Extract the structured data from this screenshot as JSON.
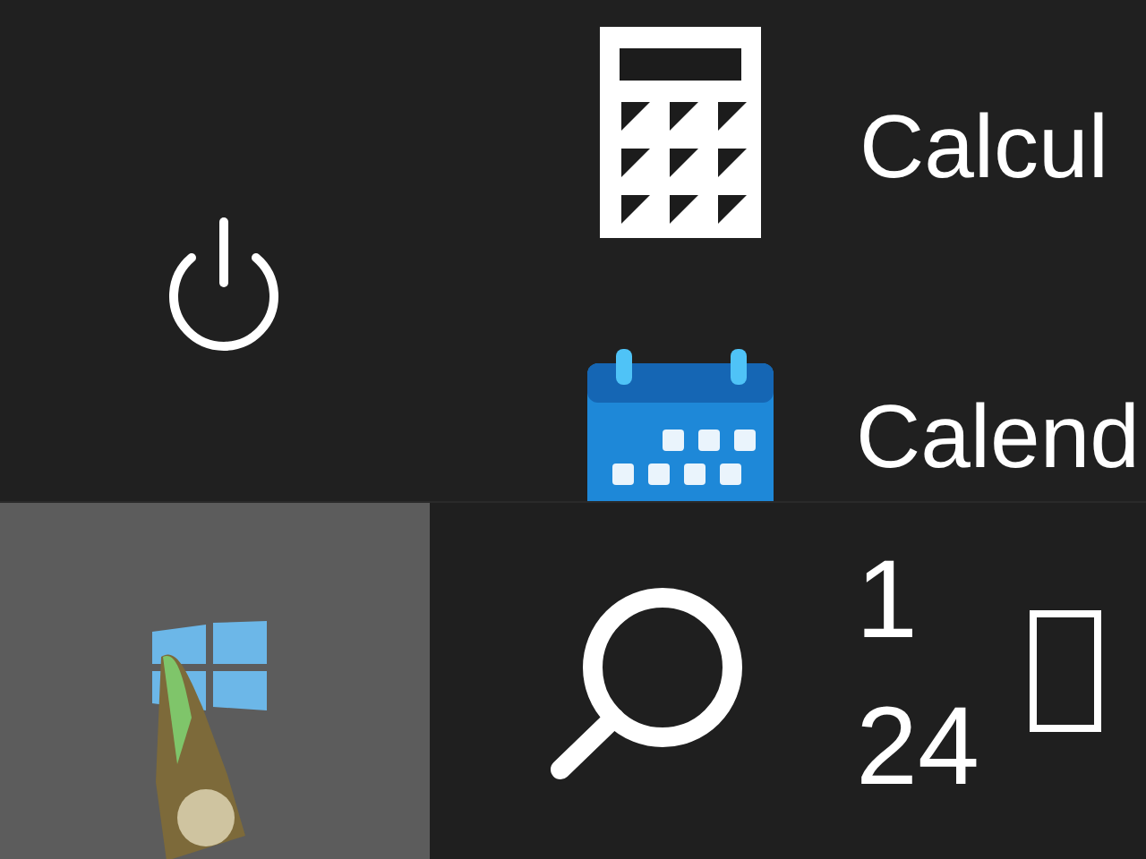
{
  "start_menu": {
    "apps": [
      {
        "kind": "calculator",
        "name": "Calcul"
      },
      {
        "kind": "calendar",
        "name": "Calend"
      }
    ]
  },
  "taskbar": {
    "start_button": {
      "selected": true
    },
    "clock": {
      "time": "1",
      "date": "24"
    }
  }
}
